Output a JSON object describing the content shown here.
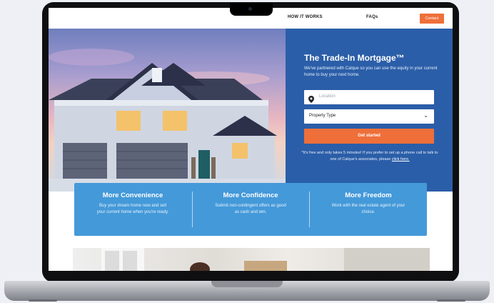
{
  "nav": {
    "how_it_works": "HOW IT WORKS",
    "faqs": "FAQs",
    "contact": "Contact"
  },
  "hero": {
    "title": "The Trade-In Mortgage™",
    "subtitle": "We've partnered with Calque so you can use the equity in your current home to buy your next home.",
    "location_placeholder": "Location",
    "property_type_label": "Property Type",
    "cta": "Get started",
    "note_text": "*It's free and only takes 5 minutes! If you prefer to set up a phone call to talk to one of Calque's associates, please ",
    "note_link": "click here."
  },
  "features": [
    {
      "title": "More Convenience",
      "desc": "Buy your dream home now and sell your current home when you're ready."
    },
    {
      "title": "More Confidence",
      "desc": "Submit non-contingent offers as good as cash and win."
    },
    {
      "title": "More Freedom",
      "desc": "Work with the real estate agent of your choice."
    }
  ],
  "colors": {
    "panel": "#2b5ea8",
    "accent": "#ef6f3a",
    "features_bg": "#4499d9"
  },
  "icons": {
    "location": "map-pin-icon",
    "dropdown": "chevron-down-icon"
  }
}
